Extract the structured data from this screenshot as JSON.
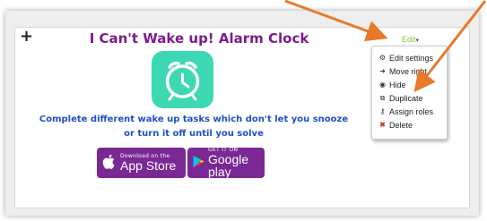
{
  "block": {
    "title": "I Can't Wake up! Alarm Clock",
    "description": "Complete different wake up tasks which don't let you snooze or turn it off until you solve"
  },
  "badges": {
    "app_store_small": "Download on the",
    "app_store_big": "App Store",
    "google_small": "GET IT ON",
    "google_big": "Google play"
  },
  "edit_menu": {
    "trigger_label": "Edit",
    "items": [
      {
        "label": "Edit settings",
        "icon": "gear-icon"
      },
      {
        "label": "Move right",
        "icon": "arrow-right-icon"
      },
      {
        "label": "Hide",
        "icon": "eye-icon"
      },
      {
        "label": "Duplicate",
        "icon": "duplicate-icon"
      },
      {
        "label": "Assign roles",
        "icon": "key-icon"
      },
      {
        "label": "Delete",
        "icon": "delete-icon"
      }
    ]
  },
  "colors": {
    "title": "#7b1d8a",
    "description": "#1f4fc8",
    "badge_bg": "#7a2894",
    "app_icon_bg": "#3ed9b2",
    "annotation_arrow": "#e8792a",
    "edit_link": "#8fbf3c",
    "delete_icon": "#d43a2a"
  }
}
